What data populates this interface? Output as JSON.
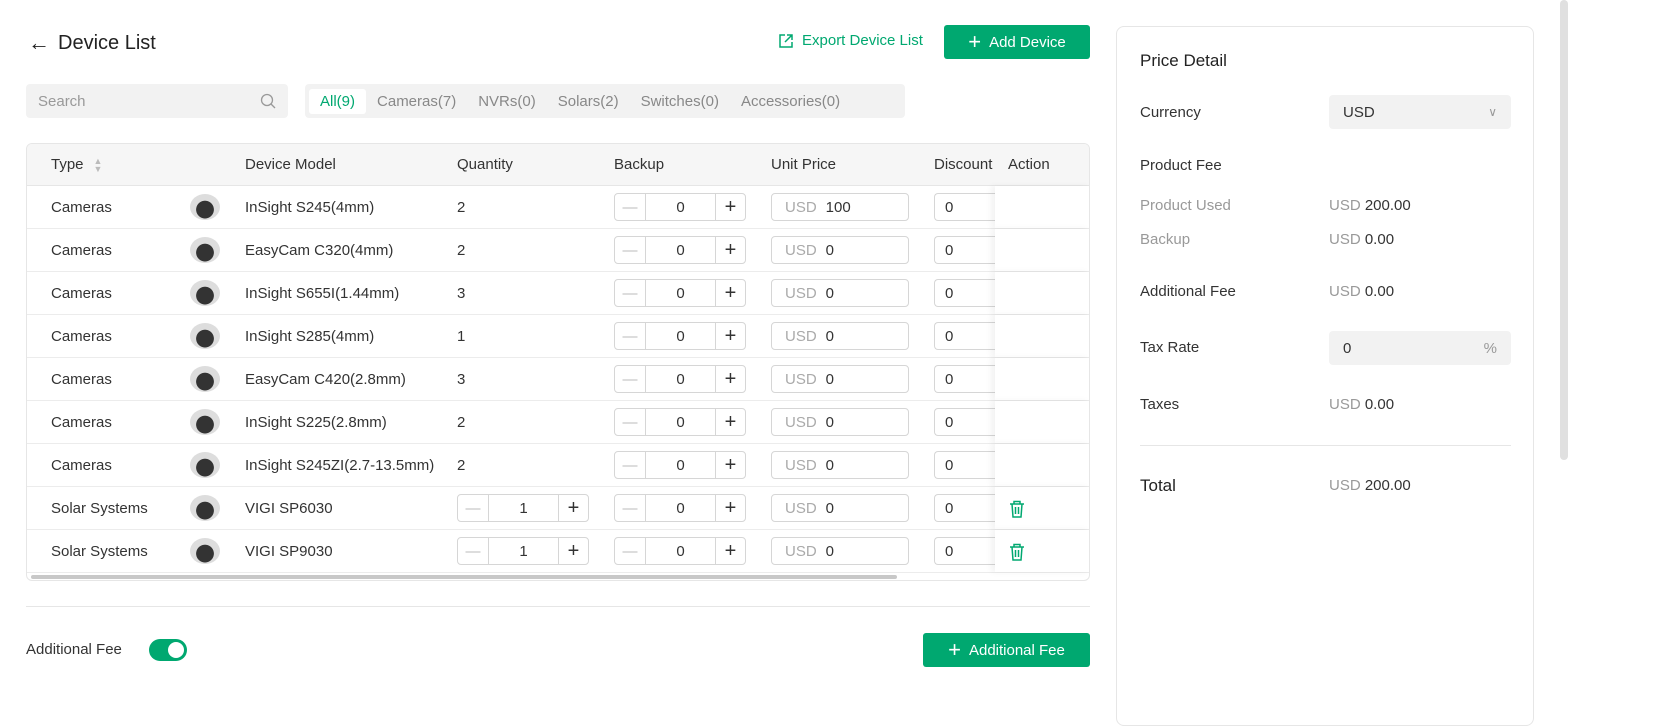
{
  "header": {
    "title": "Device List",
    "export_label": "Export Device List",
    "add_label": "Add Device"
  },
  "search": {
    "placeholder": "Search"
  },
  "tabs": [
    "All(9)",
    "Cameras(7)",
    "NVRs(0)",
    "Solars(2)",
    "Switches(0)",
    "Accessories(0)"
  ],
  "columns": {
    "type": "Type",
    "model": "Device Model",
    "quantity": "Quantity",
    "backup": "Backup",
    "unit_price": "Unit Price",
    "discount": "Discount",
    "action": "Action"
  },
  "rows": [
    {
      "type": "Cameras",
      "model": "InSight S245(4mm)",
      "quantity": "2",
      "qty_editable": false,
      "backup": "0",
      "currency": "USD",
      "price": "100",
      "discount": "0",
      "deletable": false
    },
    {
      "type": "Cameras",
      "model": "EasyCam C320(4mm)",
      "quantity": "2",
      "qty_editable": false,
      "backup": "0",
      "currency": "USD",
      "price": "0",
      "discount": "0",
      "deletable": false
    },
    {
      "type": "Cameras",
      "model": "InSight S655I(1.44mm)",
      "quantity": "3",
      "qty_editable": false,
      "backup": "0",
      "currency": "USD",
      "price": "0",
      "discount": "0",
      "deletable": false
    },
    {
      "type": "Cameras",
      "model": "InSight S285(4mm)",
      "quantity": "1",
      "qty_editable": false,
      "backup": "0",
      "currency": "USD",
      "price": "0",
      "discount": "0",
      "deletable": false
    },
    {
      "type": "Cameras",
      "model": "EasyCam C420(2.8mm)",
      "quantity": "3",
      "qty_editable": false,
      "backup": "0",
      "currency": "USD",
      "price": "0",
      "discount": "0",
      "deletable": false
    },
    {
      "type": "Cameras",
      "model": "InSight S225(2.8mm)",
      "quantity": "2",
      "qty_editable": false,
      "backup": "0",
      "currency": "USD",
      "price": "0",
      "discount": "0",
      "deletable": false
    },
    {
      "type": "Cameras",
      "model": "InSight S245ZI(2.7-13.5mm)",
      "quantity": "2",
      "qty_editable": false,
      "backup": "0",
      "currency": "USD",
      "price": "0",
      "discount": "0",
      "deletable": false
    },
    {
      "type": "Solar Systems",
      "model": "VIGI SP6030",
      "quantity": "1",
      "qty_editable": true,
      "backup": "0",
      "currency": "USD",
      "price": "0",
      "discount": "0",
      "deletable": true
    },
    {
      "type": "Solar Systems",
      "model": "VIGI SP9030",
      "quantity": "1",
      "qty_editable": true,
      "backup": "0",
      "currency": "USD",
      "price": "0",
      "discount": "0",
      "deletable": true
    }
  ],
  "additional": {
    "label": "Additional Fee",
    "toggle_on": true,
    "button_label": "Additional Fee"
  },
  "price_detail": {
    "title": "Price Detail",
    "currency_label": "Currency",
    "currency_value": "USD",
    "product_fee_label": "Product Fee",
    "product_used_label": "Product Used",
    "product_used_cur": "USD",
    "product_used_value": "200.00",
    "backup_label": "Backup",
    "backup_cur": "USD",
    "backup_value": "0.00",
    "additional_fee_label": "Additional Fee",
    "additional_fee_cur": "USD",
    "additional_fee_value": "0.00",
    "tax_rate_label": "Tax Rate",
    "tax_rate_value": "0",
    "tax_rate_unit": "%",
    "taxes_label": "Taxes",
    "taxes_cur": "USD",
    "taxes_value": "0.00",
    "total_label": "Total",
    "total_cur": "USD",
    "total_value": "200.00"
  },
  "colors": {
    "accent": "#00a870"
  }
}
